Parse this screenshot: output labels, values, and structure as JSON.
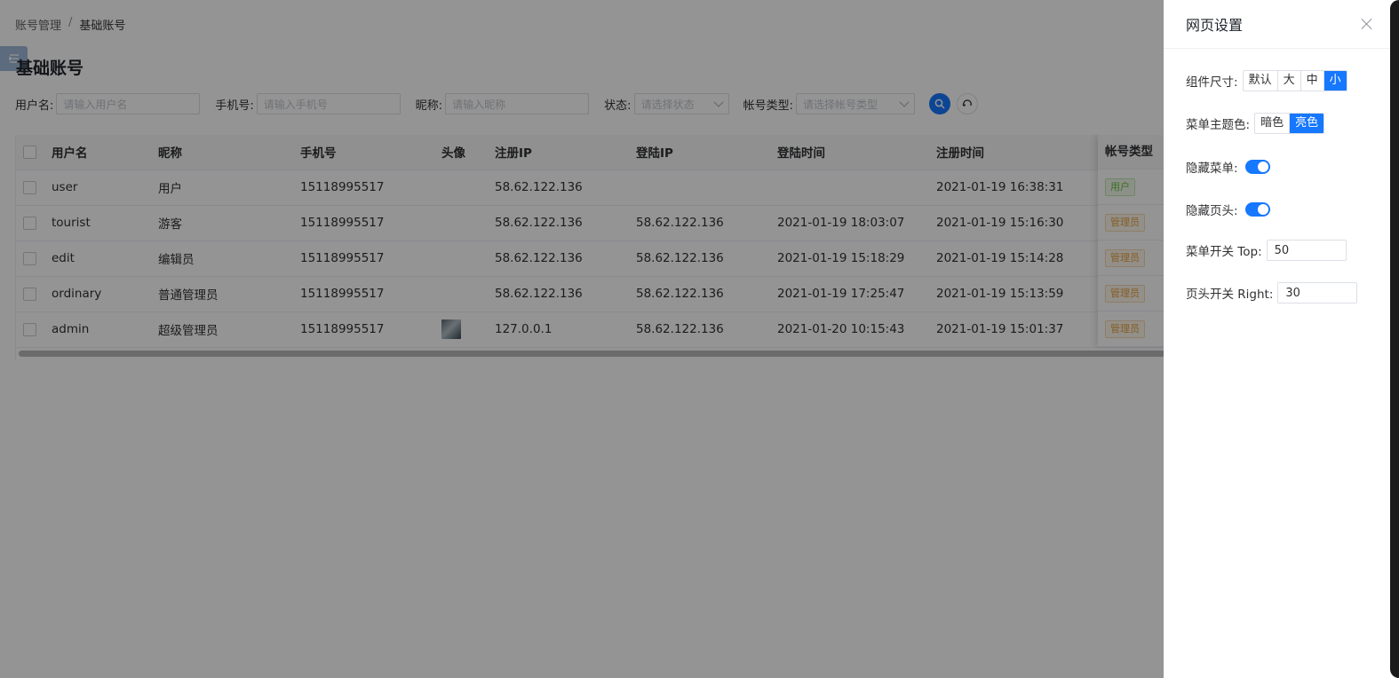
{
  "breadcrumb": {
    "parent": "账号管理",
    "separator": "/",
    "current": "基础账号"
  },
  "page": {
    "title": "基础账号"
  },
  "filters": {
    "username": {
      "label": "用户名:",
      "placeholder": "请输入用户名"
    },
    "phone": {
      "label": "手机号:",
      "placeholder": "请输入手机号"
    },
    "nickname": {
      "label": "昵称:",
      "placeholder": "请输入昵称"
    },
    "status": {
      "label": "状态:",
      "placeholder": "请选择状态"
    },
    "account_type": {
      "label": "帐号类型:",
      "placeholder": "请选择帐号类型"
    },
    "search_icon": "search-icon",
    "reset_icon": "refresh-icon"
  },
  "table": {
    "columns": [
      "用户名",
      "昵称",
      "手机号",
      "头像",
      "注册IP",
      "登陆IP",
      "登陆时间",
      "注册时间",
      "帐号类型"
    ],
    "rows": [
      {
        "username": "user",
        "nickname": "用户",
        "phone": "15118995517",
        "avatar": false,
        "reg_ip": "58.62.122.136",
        "login_ip": "",
        "login_time": "",
        "reg_time": "2021-01-19 16:38:31",
        "type": "用户",
        "type_kind": "user"
      },
      {
        "username": "tourist",
        "nickname": "游客",
        "phone": "15118995517",
        "avatar": false,
        "reg_ip": "58.62.122.136",
        "login_ip": "58.62.122.136",
        "login_time": "2021-01-19 18:03:07",
        "reg_time": "2021-01-19 15:16:30",
        "type": "管理员",
        "type_kind": "admin"
      },
      {
        "username": "edit",
        "nickname": "编辑员",
        "phone": "15118995517",
        "avatar": false,
        "reg_ip": "58.62.122.136",
        "login_ip": "58.62.122.136",
        "login_time": "2021-01-19 15:18:29",
        "reg_time": "2021-01-19 15:14:28",
        "type": "管理员",
        "type_kind": "admin"
      },
      {
        "username": "ordinary",
        "nickname": "普通管理员",
        "phone": "15118995517",
        "avatar": false,
        "reg_ip": "58.62.122.136",
        "login_ip": "58.62.122.136",
        "login_time": "2021-01-19 17:25:47",
        "reg_time": "2021-01-19 15:13:59",
        "type": "管理员",
        "type_kind": "admin"
      },
      {
        "username": "admin",
        "nickname": "超级管理员",
        "phone": "15118995517",
        "avatar": true,
        "reg_ip": "127.0.0.1",
        "login_ip": "58.62.122.136",
        "login_time": "2021-01-20 10:15:43",
        "reg_time": "2021-01-19 15:01:37",
        "type": "管理员",
        "type_kind": "admin"
      }
    ]
  },
  "drawer": {
    "title": "网页设置",
    "size": {
      "label": "组件尺寸:",
      "options": [
        "默认",
        "大",
        "中",
        "小"
      ],
      "selected": "小"
    },
    "menu_theme": {
      "label": "菜单主题色:",
      "options": [
        "暗色",
        "亮色"
      ],
      "selected": "亮色"
    },
    "hide_menu": {
      "label": "隐藏菜单:",
      "on": true
    },
    "hide_header": {
      "label": "隐藏页头:",
      "on": true
    },
    "menu_switch_top": {
      "label": "菜单开关 Top:",
      "value": "50"
    },
    "header_switch_right": {
      "label": "页头开关 Right:",
      "value": "30"
    }
  },
  "colors": {
    "primary": "#1677ff",
    "overlay": "rgba(0,0,0,0.42)",
    "tag_user": "#67c23a",
    "tag_admin": "#e6a23c"
  }
}
